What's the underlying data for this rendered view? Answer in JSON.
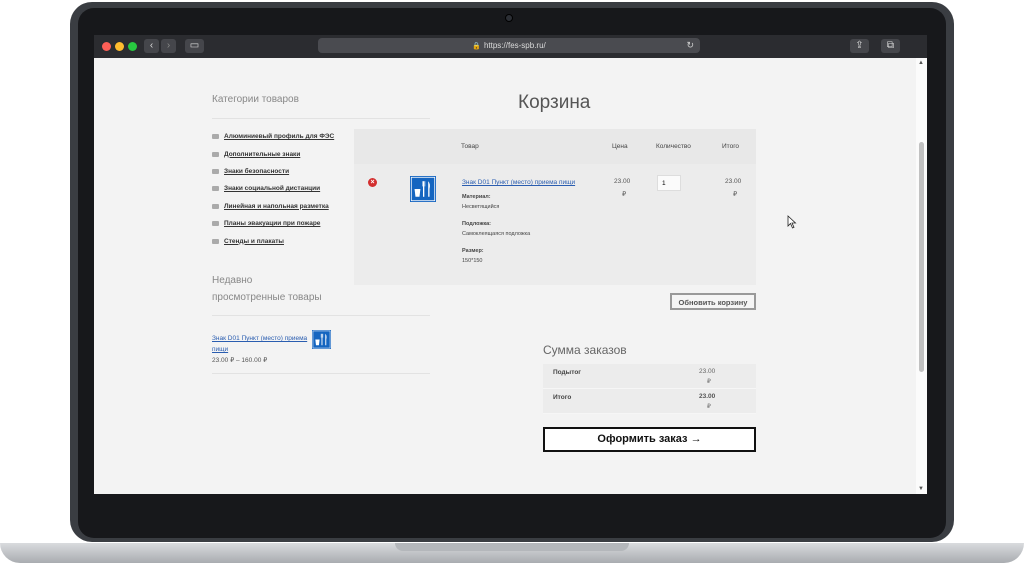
{
  "browser": {
    "url": "https://fes-spb.ru/"
  },
  "sidebar": {
    "categories_title": "Категории товаров",
    "categories": [
      "Алюминиевый профиль для ФЭС",
      "Дополнительные знаки",
      "Знаки безопасности",
      "Знаки социальной дистанции",
      "Линейная и напольная разметка",
      "Планы эвакуации при пожаре",
      "Стенды и плакаты"
    ],
    "recent_title": "Недавно просмотренные товары",
    "recent_product_name": "Знак D01 Пункт (место) приема пищи",
    "recent_product_price": "23.00 ₽ – 160.00 ₽",
    "recent_product_icon": "fork-knife-cup-sign-icon"
  },
  "cart": {
    "title": "Корзина",
    "headers": {
      "product": "Товар",
      "price": "Цена",
      "quantity": "Количество",
      "total": "Итого"
    },
    "item": {
      "name": "Знак D01 Пункт (место) приема пищи",
      "material_label": "Материал:",
      "material_value": "Несветящийся",
      "backing_label": "Подложка:",
      "backing_value": "Самоклеящаяся подложка",
      "size_label": "Размер:",
      "size_value": "150*150",
      "price": "23.00",
      "currency": "₽",
      "quantity": "1",
      "total": "23.00"
    },
    "update_button": "Обновить корзину"
  },
  "totals": {
    "title": "Сумма заказов",
    "subtotal_label": "Подытог",
    "subtotal_value": "23.00",
    "total_label": "Итого",
    "total_value": "23.00",
    "currency": "₽",
    "checkout_button": "Оформить заказ →"
  },
  "colors": {
    "sign_blue": "#1565c0",
    "remove_red": "#d32f2f",
    "link_blue": "#2a5db0"
  }
}
